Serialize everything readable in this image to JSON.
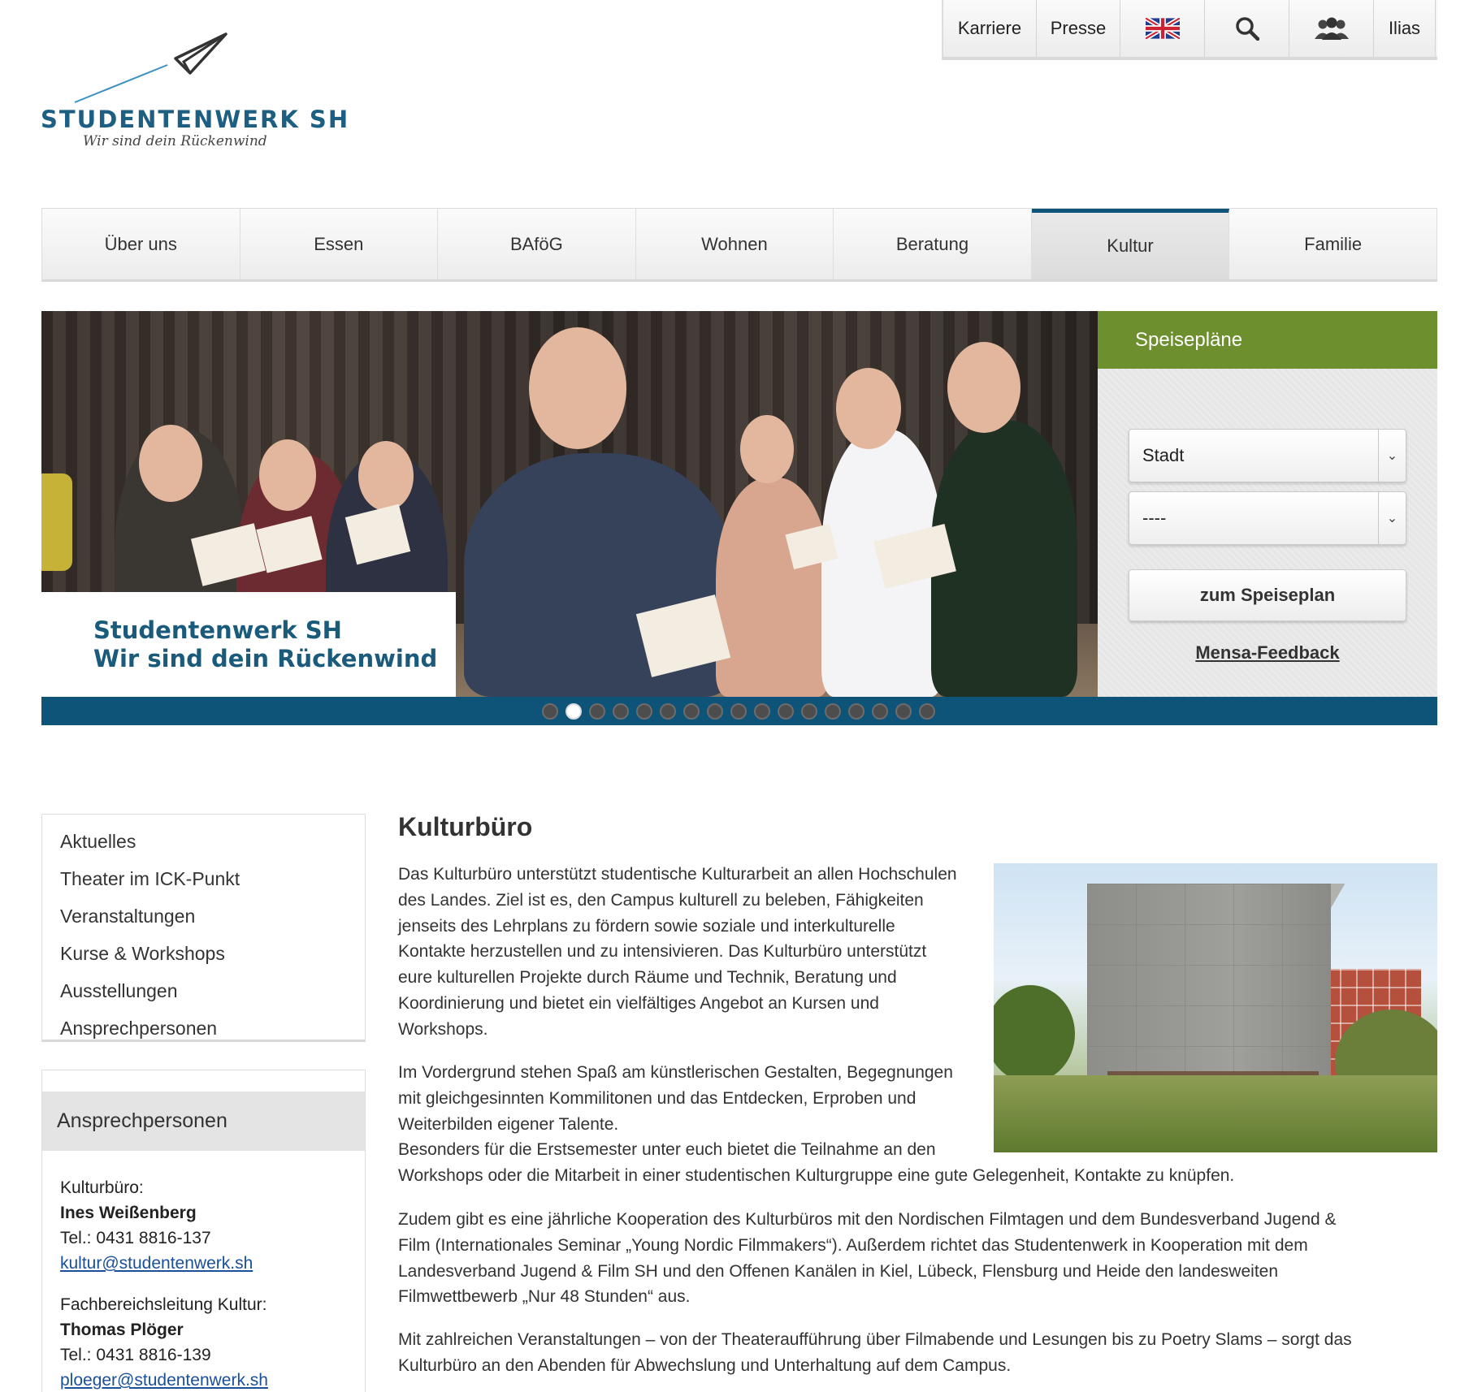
{
  "topbar": {
    "items": [
      {
        "label": "Karriere"
      },
      {
        "label": "Presse"
      },
      {
        "label": ""
      },
      {
        "label": ""
      },
      {
        "label": ""
      },
      {
        "label": "Ilias"
      }
    ],
    "icons": [
      "uk-flag-icon",
      "search-icon",
      "users-icon"
    ]
  },
  "logo": {
    "name": "STUDENTENWERK SH",
    "slogan": "Wir sind dein Rückenwind",
    "icon": "paper-plane-icon",
    "color": "#1d5f82"
  },
  "nav": {
    "items": [
      "Über uns",
      "Essen",
      "BAföG",
      "Wohnen",
      "Beratung",
      "Kultur",
      "Familie"
    ],
    "active": "Kultur",
    "accent": "#0e5378"
  },
  "hero": {
    "caption_line1": "Studentenwerk SH",
    "caption_line2": "Wir sind dein Rückenwind",
    "slides_total": 17,
    "active_slide": 2
  },
  "speiseplaene": {
    "title": "Speisepläne",
    "select_city": "Stadt",
    "select_mensa": "----",
    "button": "zum Speiseplan",
    "feedback_link": "Mensa-Feedback",
    "header_color": "#6e8f2d"
  },
  "sidebar": {
    "items": [
      "Aktuelles",
      "Theater im ICK-Punkt",
      "Veranstaltungen",
      "Kurse & Workshops",
      "Ausstellungen",
      "Ansprechpersonen"
    ],
    "contact": {
      "title": "Ansprechpersonen",
      "role1": "Kulturbüro:",
      "name1": "Ines Weißenberg",
      "phone1": "Tel.: 0431 8816-137",
      "email1": "kultur@studentenwerk.sh",
      "role2": "Fachbereichsleitung Kultur:",
      "name2": "Thomas Plöger",
      "phone2": "Tel.: 0431 8816-139",
      "email2": "ploeger@studentenwerk.sh"
    }
  },
  "content": {
    "title": "Kulturbüro",
    "p1": [
      "Das Kulturbüro unterstützt studentische Kulturarbeit an allen Hochschulen",
      "des Landes. Ziel ist es, den Campus kulturell zu beleben, Fähigkeiten",
      "jenseits des Lehrplans zu fördern sowie soziale und interkulturelle",
      "Kontakte herzustellen und zu intensivieren. Das Kulturbüro unterstützt",
      "eure kulturellen Projekte durch Räume und Technik, Beratung und",
      "Koordinierung und bietet ein vielfältiges Angebot an Kursen und",
      "Workshops."
    ],
    "p2": [
      "Im Vordergrund stehen Spaß am künstlerischen Gestalten, Begegnungen",
      "mit gleichgesinnten Kommilitonen und das Entdecken, Erproben und",
      "Weiterbilden eigener Talente.",
      "Besonders für die Erstsemester unter euch bietet die Teilnahme an den",
      "Workshops oder die Mitarbeit in einer studentischen Kulturgruppe eine gute Gelegenheit, Kontakte zu knüpfen."
    ],
    "p3": [
      "Zudem gibt es eine jährliche Kooperation des Kulturbüros mit den Nordischen Filmtagen und dem Bundesverband Jugend &",
      "Film (Internationales Seminar „Young Nordic Filmmakers“). Außerdem richtet das Studentenwerk in Kooperation mit dem",
      "Landesverband Jugend & Film SH und den Offenen Kanälen in Kiel, Lübeck, Flensburg und Heide den landesweiten",
      "Filmwettbewerb „Nur 48 Stunden“ aus."
    ],
    "p4": [
      "Mit zahlreichen Veranstaltungen – von der Theateraufführung über Filmabende und Lesungen bis zu Poetry Slams – sorgt das",
      "Kulturbüro an den Abenden für Abwechslung und Unterhaltung auf dem Campus."
    ]
  }
}
